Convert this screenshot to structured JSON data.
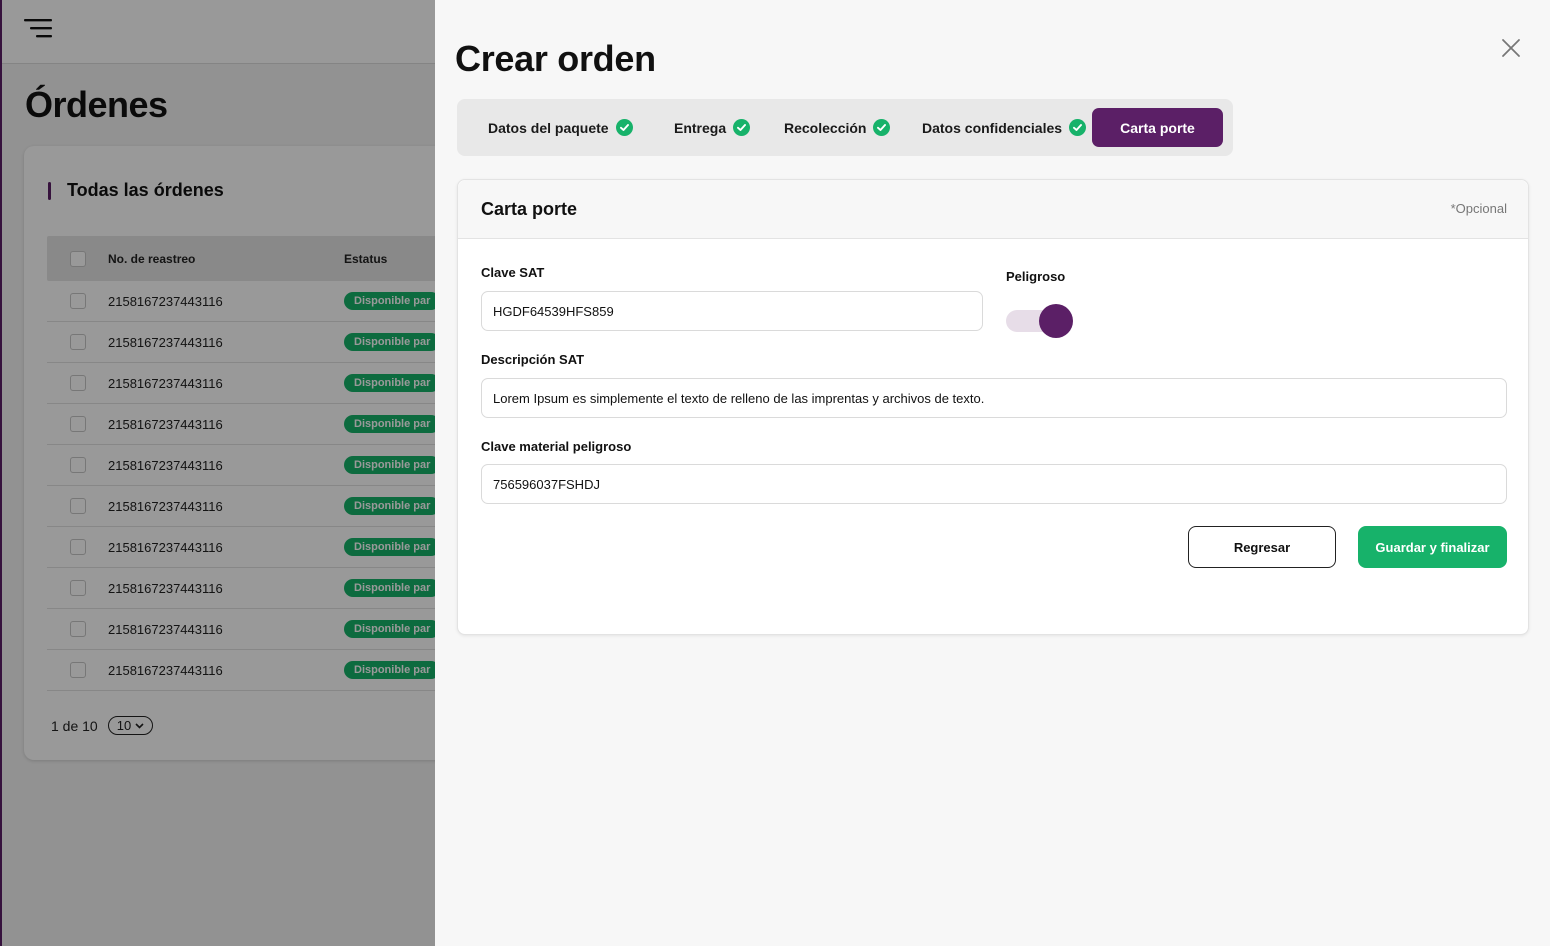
{
  "background": {
    "page_title": "Órdenes",
    "card_title": "Todas las órdenes",
    "table": {
      "headers": {
        "tracking": "No. de reastreo",
        "status": "Estatus"
      },
      "rows": [
        {
          "tracking": "2158167237443116",
          "status": "Disponible par"
        },
        {
          "tracking": "2158167237443116",
          "status": "Disponible par"
        },
        {
          "tracking": "2158167237443116",
          "status": "Disponible par"
        },
        {
          "tracking": "2158167237443116",
          "status": "Disponible par"
        },
        {
          "tracking": "2158167237443116",
          "status": "Disponible par"
        },
        {
          "tracking": "2158167237443116",
          "status": "Disponible par"
        },
        {
          "tracking": "2158167237443116",
          "status": "Disponible par"
        },
        {
          "tracking": "2158167237443116",
          "status": "Disponible par"
        },
        {
          "tracking": "2158167237443116",
          "status": "Disponible par"
        },
        {
          "tracking": "2158167237443116",
          "status": "Disponible par"
        }
      ]
    },
    "pagination": {
      "text": "1 de 10",
      "page_size": "10"
    }
  },
  "drawer": {
    "title": "Crear orden",
    "steps": [
      {
        "label": "Datos del paquete",
        "completed": true
      },
      {
        "label": "Entrega",
        "completed": true
      },
      {
        "label": "Recolección",
        "completed": true
      },
      {
        "label": "Datos confidenciales",
        "completed": true
      },
      {
        "label": "Carta porte",
        "active": true
      }
    ],
    "form": {
      "title": "Carta porte",
      "optional_note": "*Opcional",
      "clave_sat": {
        "label": "Clave SAT",
        "value": "HGDF64539HFS859"
      },
      "peligroso": {
        "label": "Peligroso",
        "checked": true
      },
      "descripcion_sat": {
        "label": "Descripción SAT",
        "value": "Lorem Ipsum es simplemente el texto de relleno de las imprentas y archivos de texto."
      },
      "clave_material": {
        "label": "Clave material peligroso",
        "value": "756596037FSHDJ"
      },
      "back_button": "Regresar",
      "submit_button": "Guardar y finalizar"
    }
  },
  "colors": {
    "brand_purple": "#5b1f66",
    "success_green": "#17b26a",
    "toggle_track": "#e7dde8"
  },
  "icons": [
    "menu-icon",
    "close-icon",
    "check-circle-icon",
    "chevron-down-icon"
  ]
}
